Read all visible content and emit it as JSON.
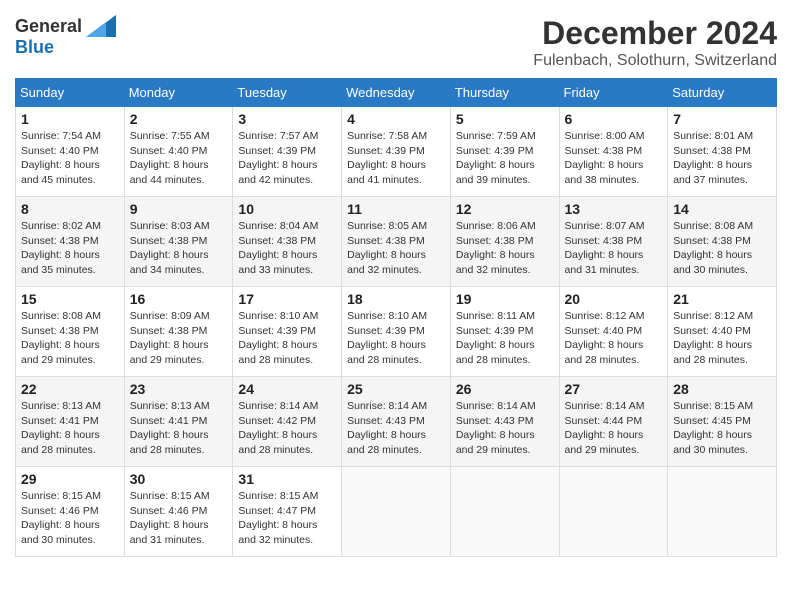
{
  "header": {
    "logo_general": "General",
    "logo_blue": "Blue",
    "month_title": "December 2024",
    "location": "Fulenbach, Solothurn, Switzerland"
  },
  "weekdays": [
    "Sunday",
    "Monday",
    "Tuesday",
    "Wednesday",
    "Thursday",
    "Friday",
    "Saturday"
  ],
  "weeks": [
    [
      {
        "day": "1",
        "sunrise": "7:54 AM",
        "sunset": "4:40 PM",
        "daylight": "8 hours and 45 minutes."
      },
      {
        "day": "2",
        "sunrise": "7:55 AM",
        "sunset": "4:40 PM",
        "daylight": "8 hours and 44 minutes."
      },
      {
        "day": "3",
        "sunrise": "7:57 AM",
        "sunset": "4:39 PM",
        "daylight": "8 hours and 42 minutes."
      },
      {
        "day": "4",
        "sunrise": "7:58 AM",
        "sunset": "4:39 PM",
        "daylight": "8 hours and 41 minutes."
      },
      {
        "day": "5",
        "sunrise": "7:59 AM",
        "sunset": "4:39 PM",
        "daylight": "8 hours and 39 minutes."
      },
      {
        "day": "6",
        "sunrise": "8:00 AM",
        "sunset": "4:38 PM",
        "daylight": "8 hours and 38 minutes."
      },
      {
        "day": "7",
        "sunrise": "8:01 AM",
        "sunset": "4:38 PM",
        "daylight": "8 hours and 37 minutes."
      }
    ],
    [
      {
        "day": "8",
        "sunrise": "8:02 AM",
        "sunset": "4:38 PM",
        "daylight": "8 hours and 35 minutes."
      },
      {
        "day": "9",
        "sunrise": "8:03 AM",
        "sunset": "4:38 PM",
        "daylight": "8 hours and 34 minutes."
      },
      {
        "day": "10",
        "sunrise": "8:04 AM",
        "sunset": "4:38 PM",
        "daylight": "8 hours and 33 minutes."
      },
      {
        "day": "11",
        "sunrise": "8:05 AM",
        "sunset": "4:38 PM",
        "daylight": "8 hours and 32 minutes."
      },
      {
        "day": "12",
        "sunrise": "8:06 AM",
        "sunset": "4:38 PM",
        "daylight": "8 hours and 32 minutes."
      },
      {
        "day": "13",
        "sunrise": "8:07 AM",
        "sunset": "4:38 PM",
        "daylight": "8 hours and 31 minutes."
      },
      {
        "day": "14",
        "sunrise": "8:08 AM",
        "sunset": "4:38 PM",
        "daylight": "8 hours and 30 minutes."
      }
    ],
    [
      {
        "day": "15",
        "sunrise": "8:08 AM",
        "sunset": "4:38 PM",
        "daylight": "8 hours and 29 minutes."
      },
      {
        "day": "16",
        "sunrise": "8:09 AM",
        "sunset": "4:38 PM",
        "daylight": "8 hours and 29 minutes."
      },
      {
        "day": "17",
        "sunrise": "8:10 AM",
        "sunset": "4:39 PM",
        "daylight": "8 hours and 28 minutes."
      },
      {
        "day": "18",
        "sunrise": "8:10 AM",
        "sunset": "4:39 PM",
        "daylight": "8 hours and 28 minutes."
      },
      {
        "day": "19",
        "sunrise": "8:11 AM",
        "sunset": "4:39 PM",
        "daylight": "8 hours and 28 minutes."
      },
      {
        "day": "20",
        "sunrise": "8:12 AM",
        "sunset": "4:40 PM",
        "daylight": "8 hours and 28 minutes."
      },
      {
        "day": "21",
        "sunrise": "8:12 AM",
        "sunset": "4:40 PM",
        "daylight": "8 hours and 28 minutes."
      }
    ],
    [
      {
        "day": "22",
        "sunrise": "8:13 AM",
        "sunset": "4:41 PM",
        "daylight": "8 hours and 28 minutes."
      },
      {
        "day": "23",
        "sunrise": "8:13 AM",
        "sunset": "4:41 PM",
        "daylight": "8 hours and 28 minutes."
      },
      {
        "day": "24",
        "sunrise": "8:14 AM",
        "sunset": "4:42 PM",
        "daylight": "8 hours and 28 minutes."
      },
      {
        "day": "25",
        "sunrise": "8:14 AM",
        "sunset": "4:43 PM",
        "daylight": "8 hours and 28 minutes."
      },
      {
        "day": "26",
        "sunrise": "8:14 AM",
        "sunset": "4:43 PM",
        "daylight": "8 hours and 29 minutes."
      },
      {
        "day": "27",
        "sunrise": "8:14 AM",
        "sunset": "4:44 PM",
        "daylight": "8 hours and 29 minutes."
      },
      {
        "day": "28",
        "sunrise": "8:15 AM",
        "sunset": "4:45 PM",
        "daylight": "8 hours and 30 minutes."
      }
    ],
    [
      {
        "day": "29",
        "sunrise": "8:15 AM",
        "sunset": "4:46 PM",
        "daylight": "8 hours and 30 minutes."
      },
      {
        "day": "30",
        "sunrise": "8:15 AM",
        "sunset": "4:46 PM",
        "daylight": "8 hours and 31 minutes."
      },
      {
        "day": "31",
        "sunrise": "8:15 AM",
        "sunset": "4:47 PM",
        "daylight": "8 hours and 32 minutes."
      },
      null,
      null,
      null,
      null
    ]
  ]
}
